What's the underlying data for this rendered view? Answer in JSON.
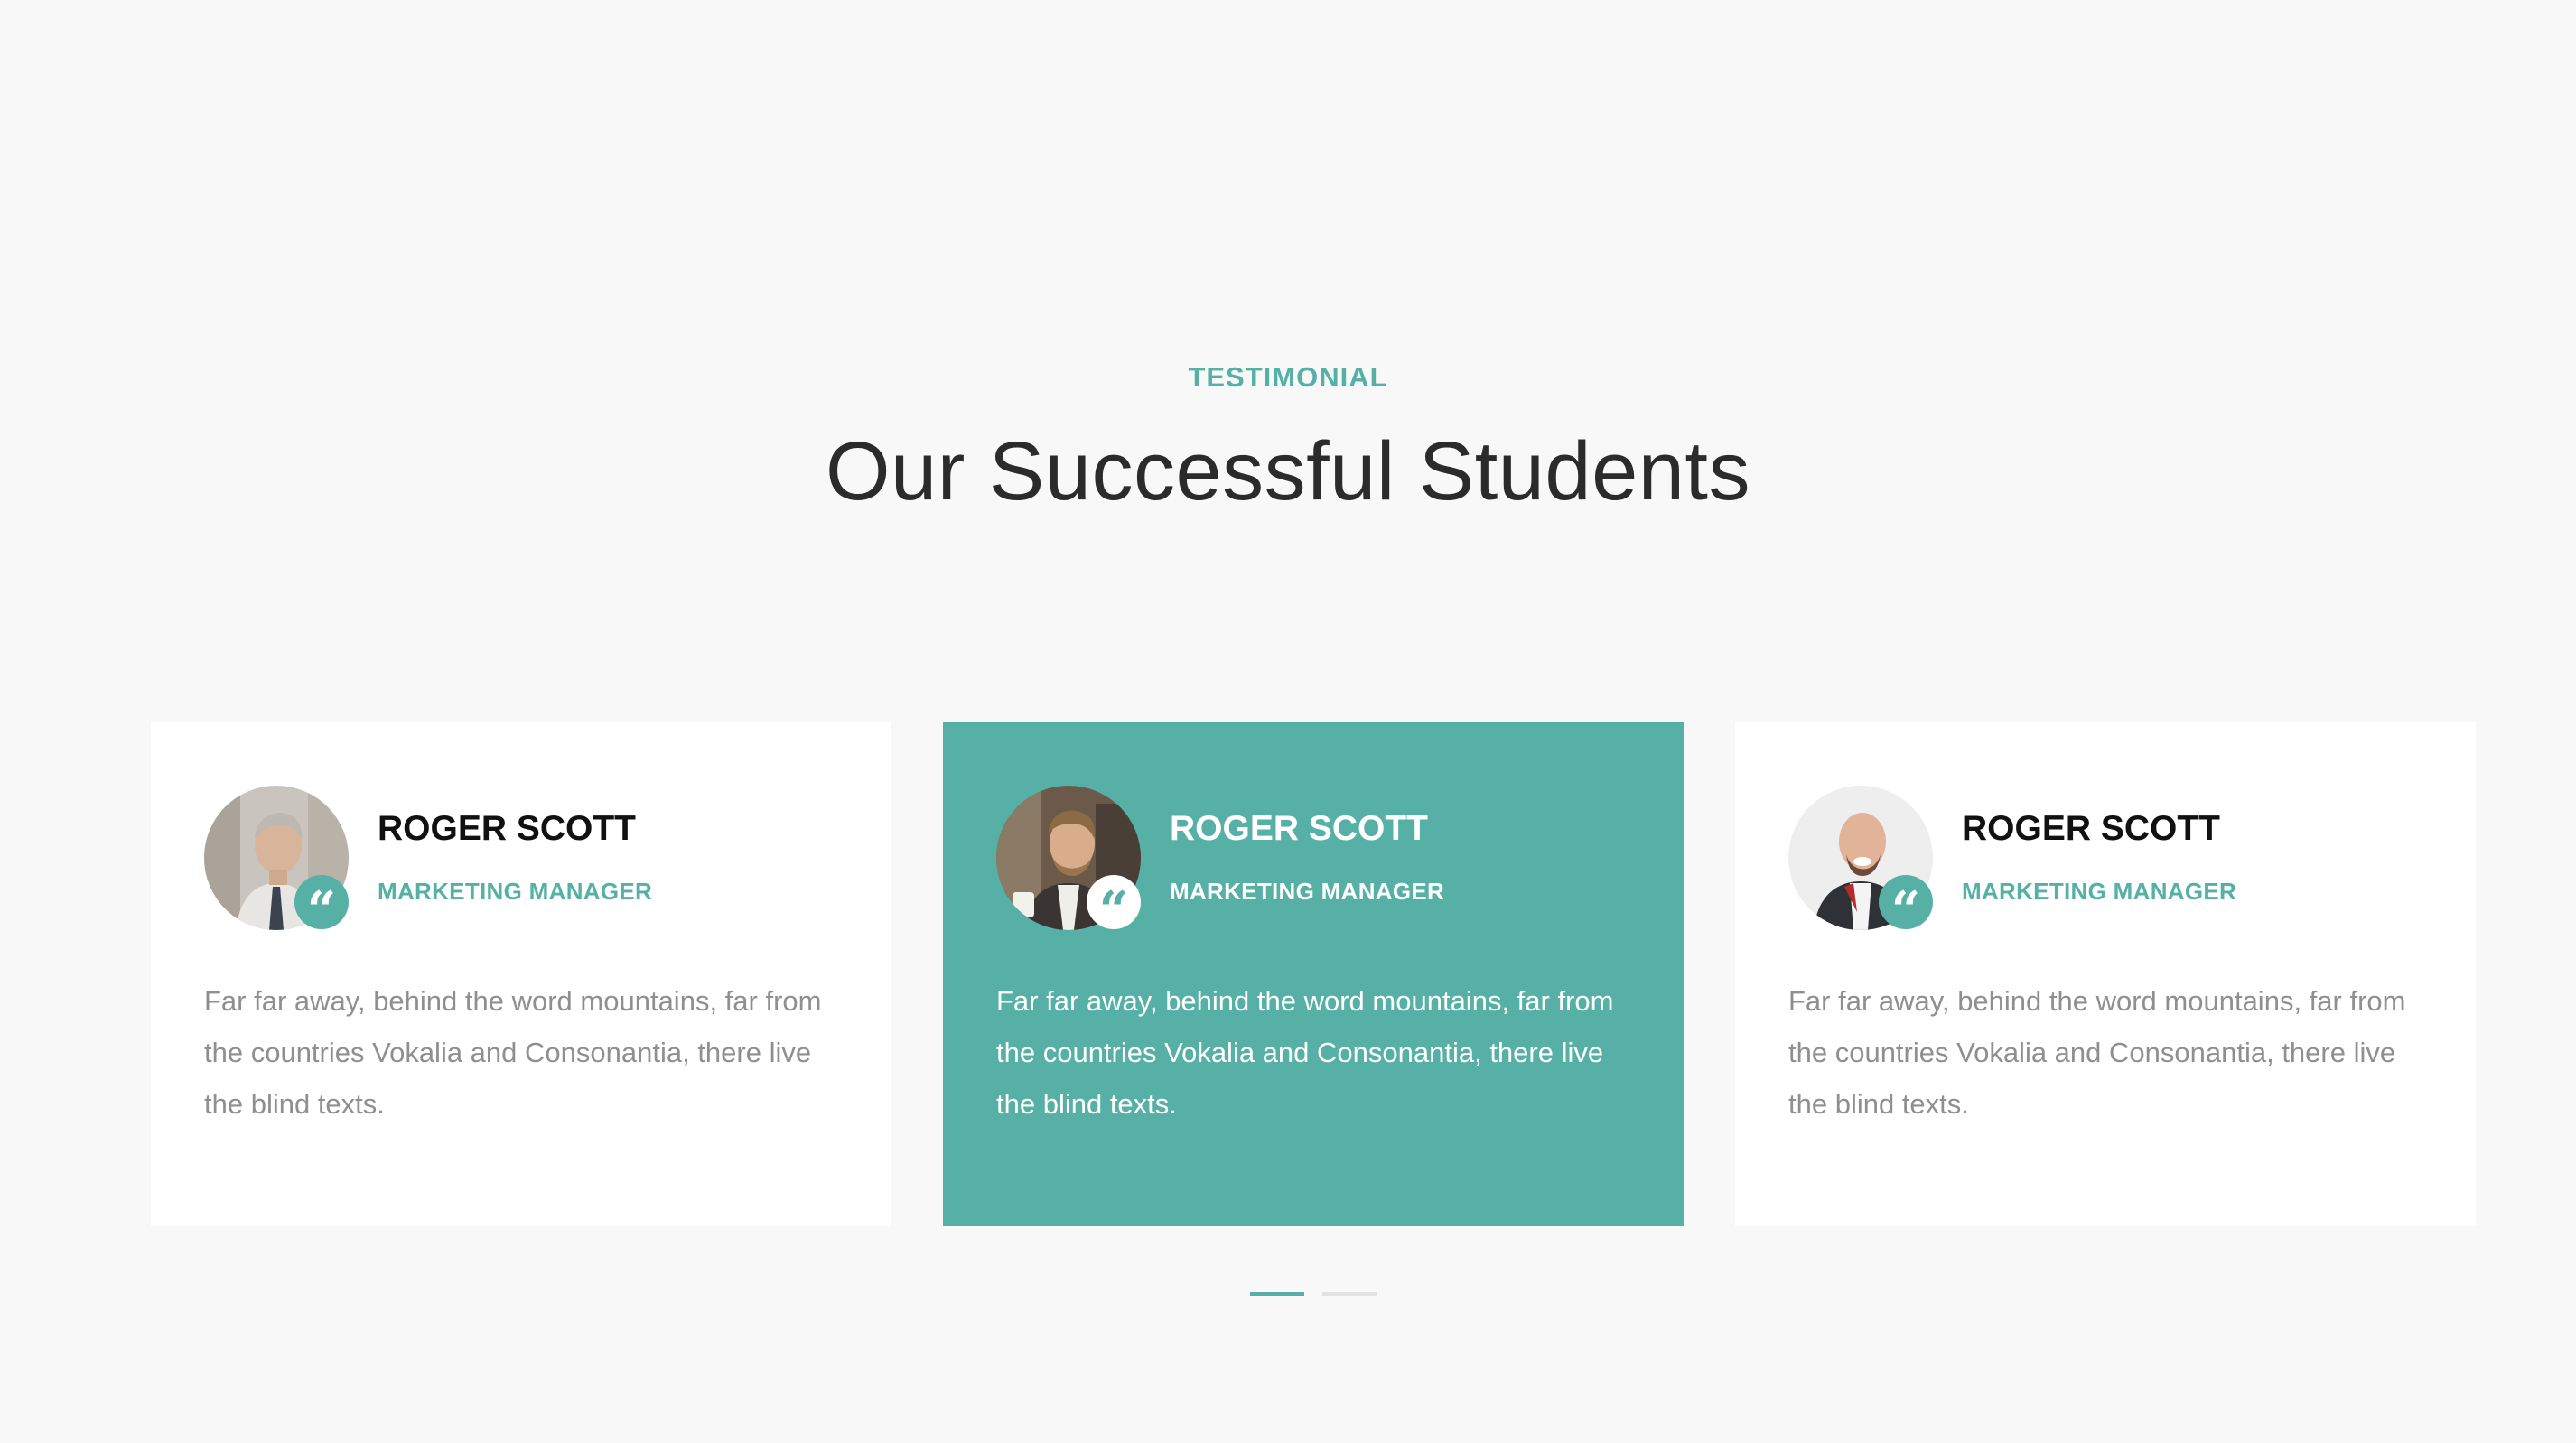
{
  "section": {
    "subtitle": "TESTIMONIAL",
    "title": "Our Successful Students"
  },
  "testimonials": [
    {
      "name": "ROGER SCOTT",
      "position": "MARKETING MANAGER",
      "text": "Far far away, behind the word mountains, far from the countries Vokalia and Consonantia, there live the blind texts.",
      "avatar_icon": "person-photo-avatar",
      "quote_icon": "quote-icon",
      "active": false
    },
    {
      "name": "ROGER SCOTT",
      "position": "MARKETING MANAGER",
      "text": "Far far away, behind the word mountains, far from the countries Vokalia and Consonantia, there live the blind texts.",
      "avatar_icon": "person-photo-avatar",
      "quote_icon": "quote-icon",
      "active": true
    },
    {
      "name": "ROGER SCOTT",
      "position": "MARKETING MANAGER",
      "text": "Far far away, behind the word mountains, far from the countries Vokalia and Consonantia, there live the blind texts.",
      "avatar_icon": "person-photo-avatar",
      "quote_icon": "quote-icon",
      "active": false
    }
  ],
  "carousel": {
    "pages": 2,
    "active_page": 1
  },
  "colors": {
    "accent": "#56b0a6",
    "background": "#f8f8f8",
    "card": "#ffffff",
    "heading": "#2b2b2b",
    "body_text": "#8f8f8f"
  }
}
